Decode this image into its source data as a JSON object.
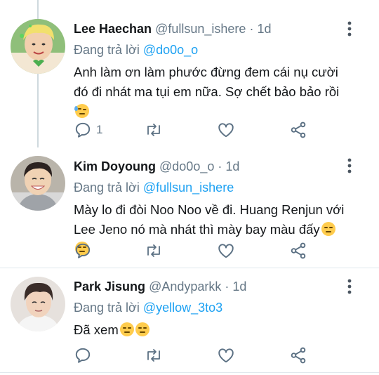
{
  "tweets": [
    {
      "name": "Lee Haechan",
      "handle": "@fullsun_ishere",
      "separator": "·",
      "time": "1d",
      "reply_prefix": "Đang trả lời",
      "reply_to": "@do0o_o",
      "text": "Anh làm ơn làm phước đừng đem cái nụ cười đó đi nhát ma tụi em nữa. Sợ chết bảo bảo rồi",
      "emojis": [
        "sweat-smile-emoji"
      ],
      "reply_count": "1",
      "avatar_bg": "#7fae6a"
    },
    {
      "name": "Kim Doyoung",
      "handle": "@do0o_o",
      "separator": "·",
      "time": "1d",
      "reply_prefix": "Đang trả lời",
      "reply_to": "@fullsun_ishere",
      "text": "Mày lo đi đòi Noo Noo về đi. Huang Renjun với Lee Jeno nó mà nhát thì mày bay màu đấy",
      "emojis": [
        "unamused-emoji",
        "unamused-emoji"
      ],
      "reply_count": "",
      "avatar_bg": "#a8a39a"
    },
    {
      "name": "Park Jisung",
      "handle": "@Andyparkk",
      "separator": "·",
      "time": "1d",
      "reply_prefix": "Đang trả lời",
      "reply_to": "@yellow_3to3",
      "text": "Đã xem",
      "emojis": [
        "unamused-emoji",
        "unamused-emoji"
      ],
      "reply_count": "",
      "avatar_bg": "#d9d4d0"
    }
  ],
  "colors": {
    "link": "#1da1f2",
    "secondary": "#657786",
    "text": "#14171a",
    "divider": "#e1e8ed"
  }
}
